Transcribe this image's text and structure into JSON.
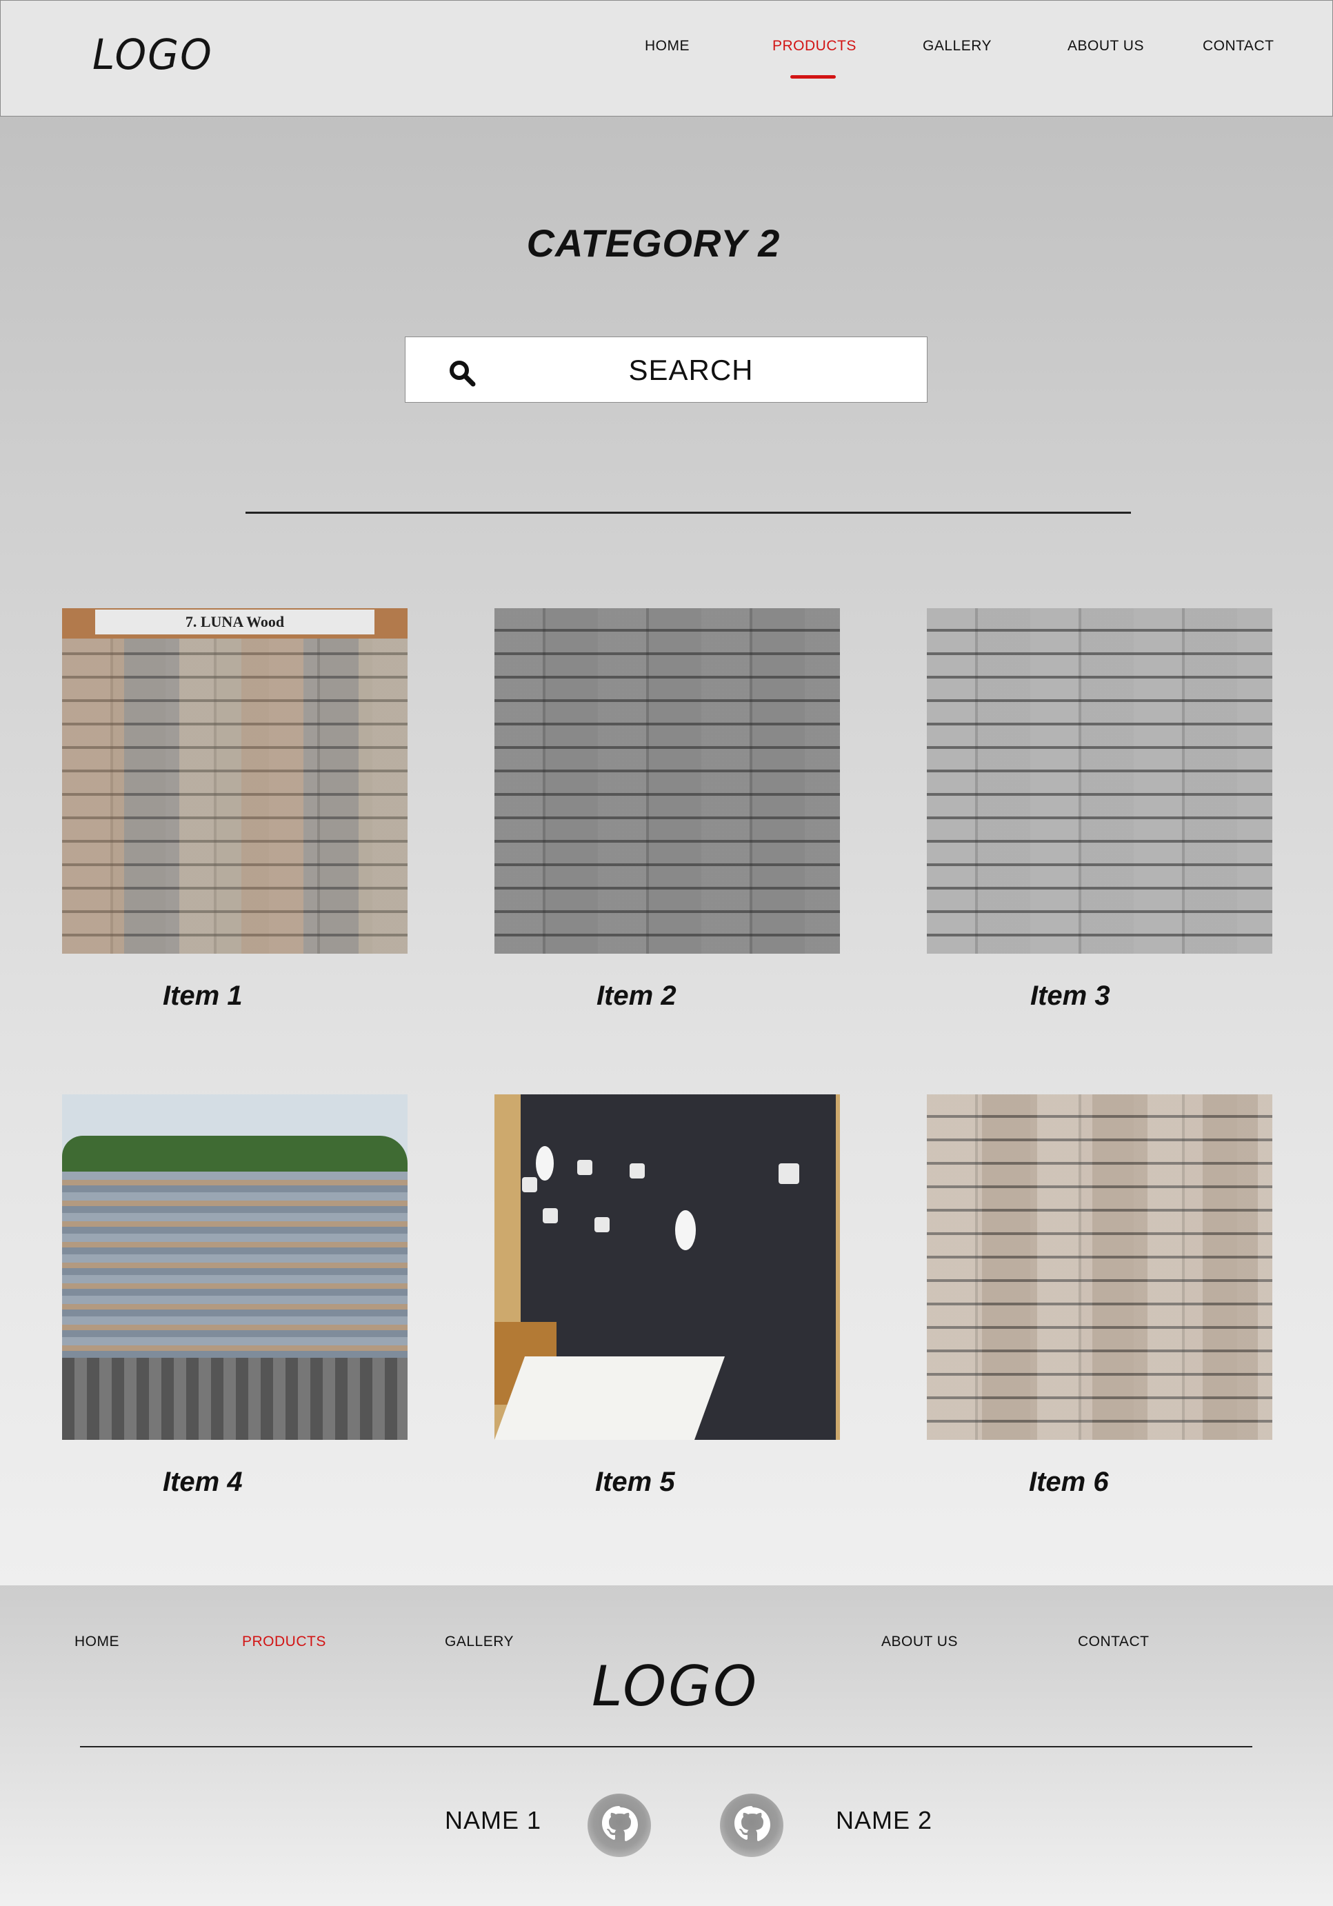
{
  "header": {
    "logo": "LOGO",
    "nav": [
      "HOME",
      "PRODUCTS",
      "GALLERY",
      "ABOUT US",
      "CONTACT"
    ],
    "active_nav": "PRODUCTS"
  },
  "colors": {
    "accent": "#d21414",
    "header_bg": "#e6e6e6"
  },
  "main": {
    "title": "CATEGORY 2",
    "search": {
      "label": "SEARCH",
      "icon": "search-icon"
    }
  },
  "products": [
    {
      "name": "Item 1",
      "sign": "7. LUNA Wood"
    },
    {
      "name": "Item 2"
    },
    {
      "name": "Item 3"
    },
    {
      "name": "Item 4"
    },
    {
      "name": "Item 5"
    },
    {
      "name": "Item 6"
    }
  ],
  "footer": {
    "nav": [
      "HOME",
      "PRODUCTS",
      "GALLERY",
      "ABOUT US",
      "CONTACT"
    ],
    "logo": "LOGO",
    "members": [
      {
        "name": "NAME 1",
        "icon": "github-icon"
      },
      {
        "name": "NAME 2",
        "icon": "github-icon"
      }
    ]
  }
}
